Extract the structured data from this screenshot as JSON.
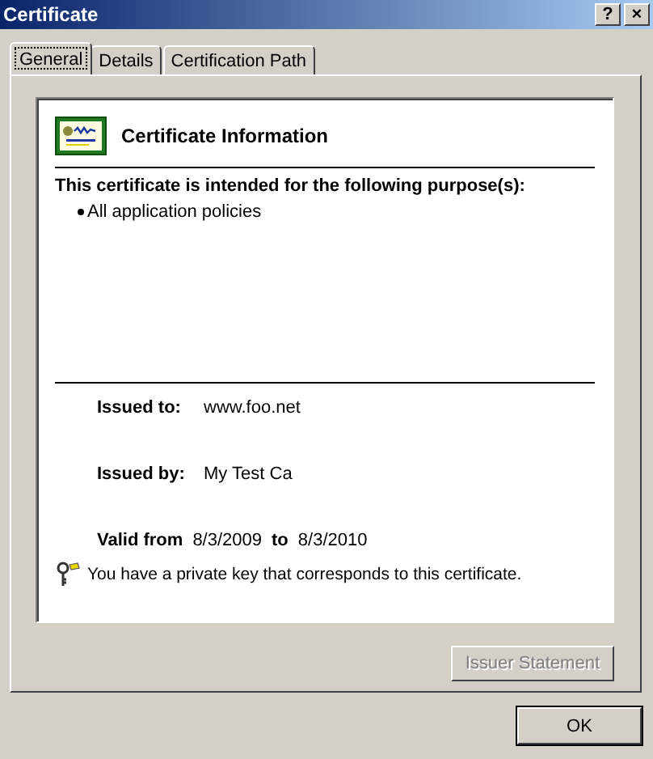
{
  "window": {
    "title": "Certificate"
  },
  "title_buttons": [
    "?",
    "×"
  ],
  "tabs": [
    {
      "label": "General",
      "selected": true
    },
    {
      "label": "Details",
      "selected": false
    },
    {
      "label": "Certification Path",
      "selected": false
    }
  ],
  "certificate": {
    "heading": "Certificate Information",
    "purpose_heading": "This certificate is intended for the following purpose(s):",
    "purposes": [
      "All application policies"
    ],
    "issued_to": {
      "label": "Issued to:",
      "value": "www.foo.net"
    },
    "issued_by": {
      "label": "Issued by:",
      "value": "My Test Ca"
    },
    "valid": {
      "from_label": "Valid from",
      "from": "8/3/2009",
      "to_label": "to",
      "to": "8/3/2010"
    },
    "private_key_note": "You have a private key that corresponds to this certificate."
  },
  "issuer_statement_button": {
    "label": "Issuer Statement",
    "disabled": true
  },
  "buttons": [
    {
      "label": "OK"
    }
  ]
}
